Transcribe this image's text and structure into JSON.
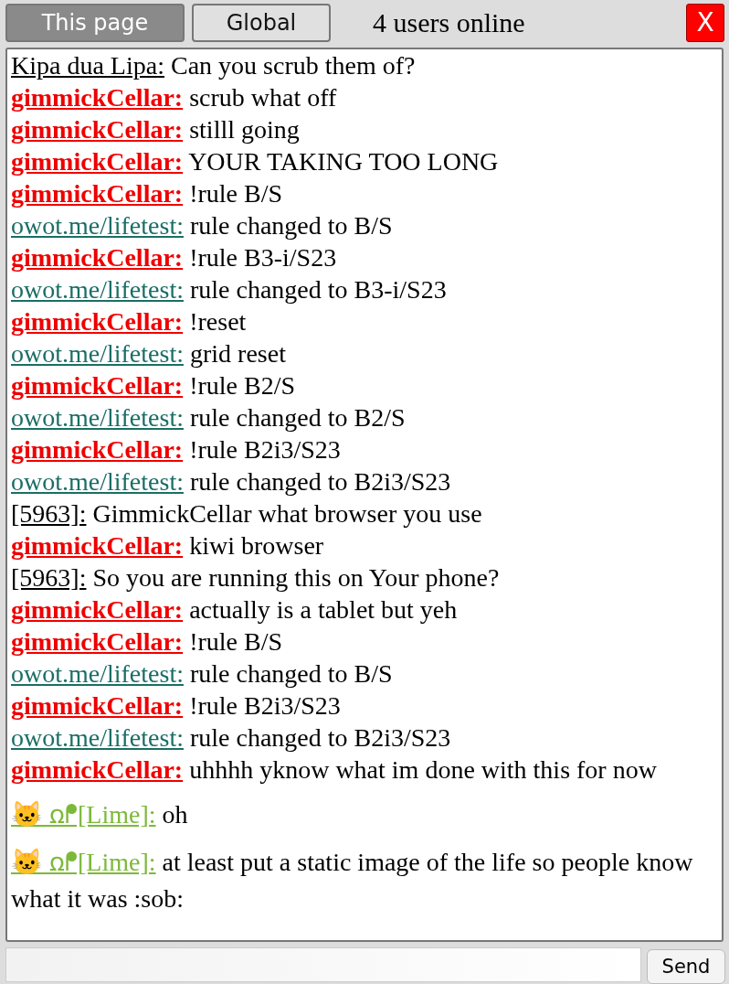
{
  "tabs": [
    {
      "label": "This page",
      "selected": true
    },
    {
      "label": "Global",
      "selected": false
    }
  ],
  "online": "4 users online",
  "close": "X",
  "messages": [
    {
      "kind": "anon",
      "name": "Kipa dua Lipa:",
      "text": "Can you scrub them of?"
    },
    {
      "kind": "op",
      "name": "gimmickCellar:",
      "text": "scrub what off"
    },
    {
      "kind": "op",
      "name": "gimmickCellar:",
      "text": "stilll going"
    },
    {
      "kind": "op",
      "name": "gimmickCellar:",
      "text": "YOUR TAKING TOO LONG"
    },
    {
      "kind": "op",
      "name": "gimmickCellar:",
      "text": "!rule B/S"
    },
    {
      "kind": "bot",
      "name": "owot.me/lifetest:",
      "text": "rule changed to B/S"
    },
    {
      "kind": "op",
      "name": "gimmickCellar:",
      "text": "!rule B3-i/S23"
    },
    {
      "kind": "bot",
      "name": "owot.me/lifetest:",
      "text": "rule changed to B3-i/S23"
    },
    {
      "kind": "op",
      "name": "gimmickCellar:",
      "text": "!reset"
    },
    {
      "kind": "bot",
      "name": "owot.me/lifetest:",
      "text": "grid reset"
    },
    {
      "kind": "op",
      "name": "gimmickCellar:",
      "text": "!rule B2/S"
    },
    {
      "kind": "bot",
      "name": "owot.me/lifetest:",
      "text": "rule changed to B2/S"
    },
    {
      "kind": "op",
      "name": "gimmickCellar:",
      "text": "!rule B2i3/S23"
    },
    {
      "kind": "bot",
      "name": "owot.me/lifetest:",
      "text": "rule changed to B2i3/S23"
    },
    {
      "kind": "anon",
      "name": "[5963]:",
      "text": "GimmickCellar what browser you use"
    },
    {
      "kind": "op",
      "name": "gimmickCellar:",
      "text": "kiwi browser"
    },
    {
      "kind": "anon",
      "name": "[5963]:",
      "text": "So you are running this on Your phone?"
    },
    {
      "kind": "op",
      "name": "gimmickCellar:",
      "text": "actually is a tablet but yeh"
    },
    {
      "kind": "op",
      "name": "gimmickCellar:",
      "text": "!rule B/S"
    },
    {
      "kind": "bot",
      "name": "owot.me/lifetest:",
      "text": "rule changed to B/S"
    },
    {
      "kind": "op",
      "name": "gimmickCellar:",
      "text": "!rule B2i3/S23"
    },
    {
      "kind": "bot",
      "name": "owot.me/lifetest:",
      "text": "rule changed to B2i3/S23"
    },
    {
      "kind": "op",
      "name": "gimmickCellar:",
      "text": "uhhhh yknow what im done with this for now"
    },
    {
      "kind": "lime",
      "name": "🐱 ꭥᖰ[Lime]:",
      "text": "oh"
    },
    {
      "kind": "lime",
      "name": "🐱 ꭥᖰ[Lime]:",
      "text": "at least put a static image of the life so people know what it was :sob:"
    }
  ],
  "send": "Send"
}
